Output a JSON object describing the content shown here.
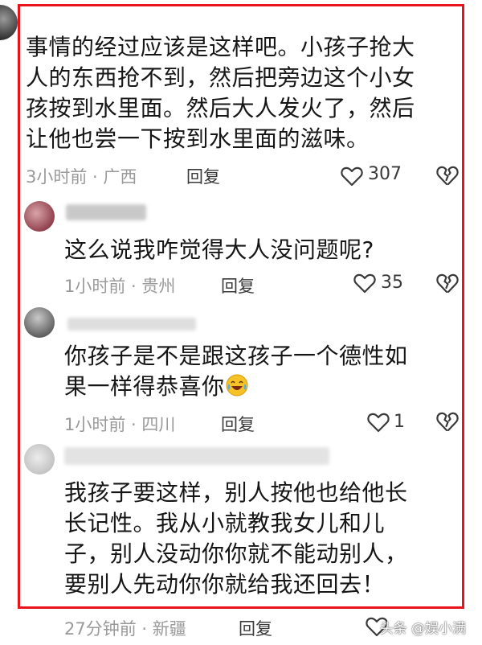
{
  "main_comment": {
    "text": "事情的经过应该是这样吧。小孩子抢大\n人的东西抢不到，然后把旁边这个小女\n孩按到水里面。然后大人发火了，然后\n让他也尝一下按到水里面的滋味。",
    "meta": "3小时前 · 广西",
    "reply_label": "回复",
    "likes": "307"
  },
  "replies": [
    {
      "text": "这么说我咋觉得大人没问题呢?",
      "meta": "1小时前 · 贵州",
      "reply_label": "回复",
      "likes": "35"
    },
    {
      "text": "你孩子是不是跟这孩子一个德性如\n果一样得恭喜你",
      "emoji": "laughing-crying-emoji",
      "meta": "1小时前 · 四川",
      "reply_label": "回复",
      "likes": "1"
    },
    {
      "text": "我孩子要这样，别人按他也给他长\n长记性。我从小就教我女儿和儿\n子，别人没动你你就不能动别人，\n要别人先动你你就给我还回去！",
      "meta": "27分钟前 · 新疆",
      "reply_label": "回复",
      "likes": ""
    }
  ],
  "watermark": "头条 @娱小满",
  "colors": {
    "frame": "#e8141b",
    "meta": "#9a9a9a",
    "text": "#161616"
  },
  "icons": [
    "heart-outline-icon",
    "broken-heart-icon"
  ]
}
